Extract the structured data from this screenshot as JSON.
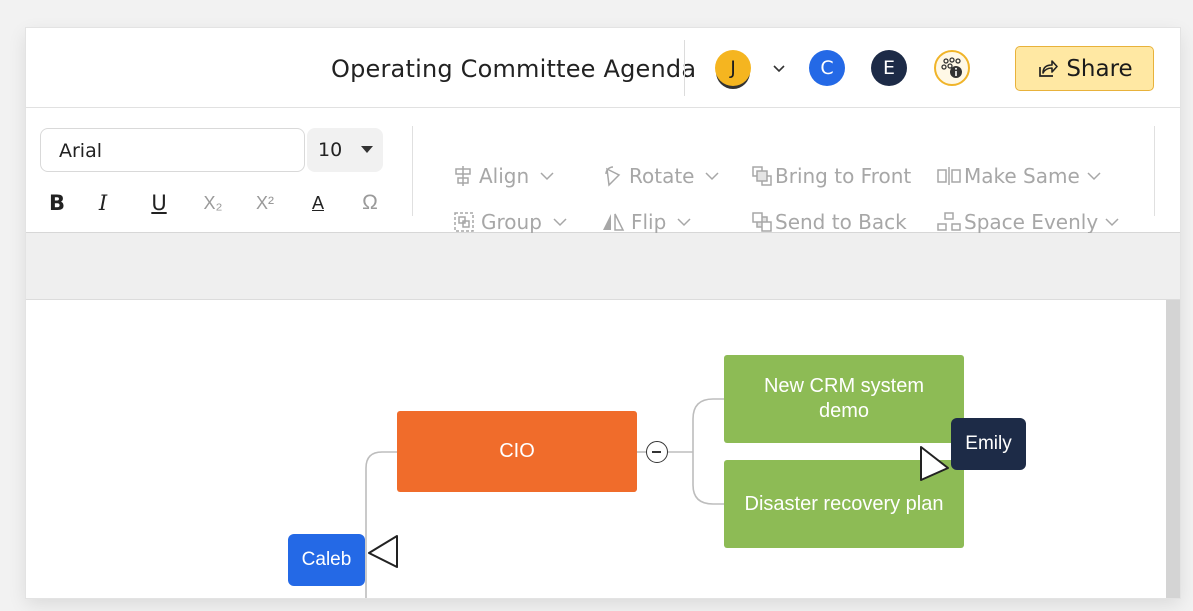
{
  "header": {
    "title": "Operating Committee Agenda",
    "avatars": [
      {
        "initial": "J",
        "color": "#f5b520"
      },
      {
        "initial": "C",
        "color": "#2469e6"
      },
      {
        "initial": "E",
        "color": "#1d2b47"
      }
    ],
    "collaborators_icon": "people-info-icon",
    "share_label": "Share"
  },
  "toolbar": {
    "font_family": "Arial",
    "font_size": "10",
    "format_buttons": [
      {
        "name": "bold",
        "glyph": "B"
      },
      {
        "name": "italic",
        "glyph": "I"
      },
      {
        "name": "underline",
        "glyph": "U"
      },
      {
        "name": "subscript",
        "glyph": "X₂"
      },
      {
        "name": "superscript",
        "glyph": "X²"
      },
      {
        "name": "font-color",
        "glyph": "A"
      },
      {
        "name": "special-character",
        "glyph": "Ω"
      }
    ],
    "align_label": "Align",
    "rotate_label": "Rotate",
    "bring_to_front_label": "Bring to Front",
    "make_same_label": "Make Same",
    "group_label": "Group",
    "flip_label": "Flip",
    "send_to_back_label": "Send to Back",
    "space_evenly_label": "Space Evenly"
  },
  "diagram": {
    "root": {
      "label": "CIO",
      "color": "#f06c2b"
    },
    "children": [
      {
        "label": "New CRM system demo",
        "color": "#8dbb55"
      },
      {
        "label": "Disaster recovery plan",
        "color": "#8dbb55"
      }
    ]
  },
  "cursors": [
    {
      "name": "Emily",
      "color": "#1d2b47"
    },
    {
      "name": "Caleb",
      "color": "#2469e6"
    }
  ]
}
